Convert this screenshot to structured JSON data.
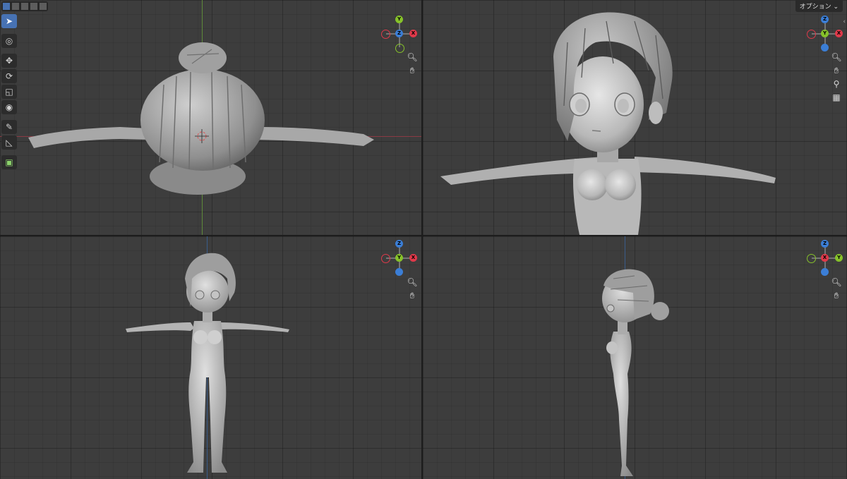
{
  "header": {
    "select_modes": [
      "select-box",
      "select-extend",
      "select-subtract",
      "select-invert",
      "select-intersect"
    ],
    "options_label": "オプション",
    "options_chevron": "⌄"
  },
  "toolbar": {
    "tools": [
      "select-box-icon",
      "cursor-icon",
      "move-icon",
      "rotate-icon",
      "scale-icon",
      "transform-icon",
      "annotate-icon",
      "measure-icon",
      "add-cube-icon"
    ]
  },
  "gizmo_labels": {
    "x": "X",
    "y": "Y",
    "z": "Z"
  },
  "colors": {
    "x": "#e0394a",
    "y": "#86c22a",
    "z": "#3b7ed6",
    "active": "#4772b3"
  },
  "viewports": [
    {
      "name": "top-view",
      "gizmo": "top"
    },
    {
      "name": "front-closeup-view",
      "gizmo": "front-persp"
    },
    {
      "name": "front-view",
      "gizmo": "front"
    },
    {
      "name": "side-view",
      "gizmo": "right"
    }
  ]
}
